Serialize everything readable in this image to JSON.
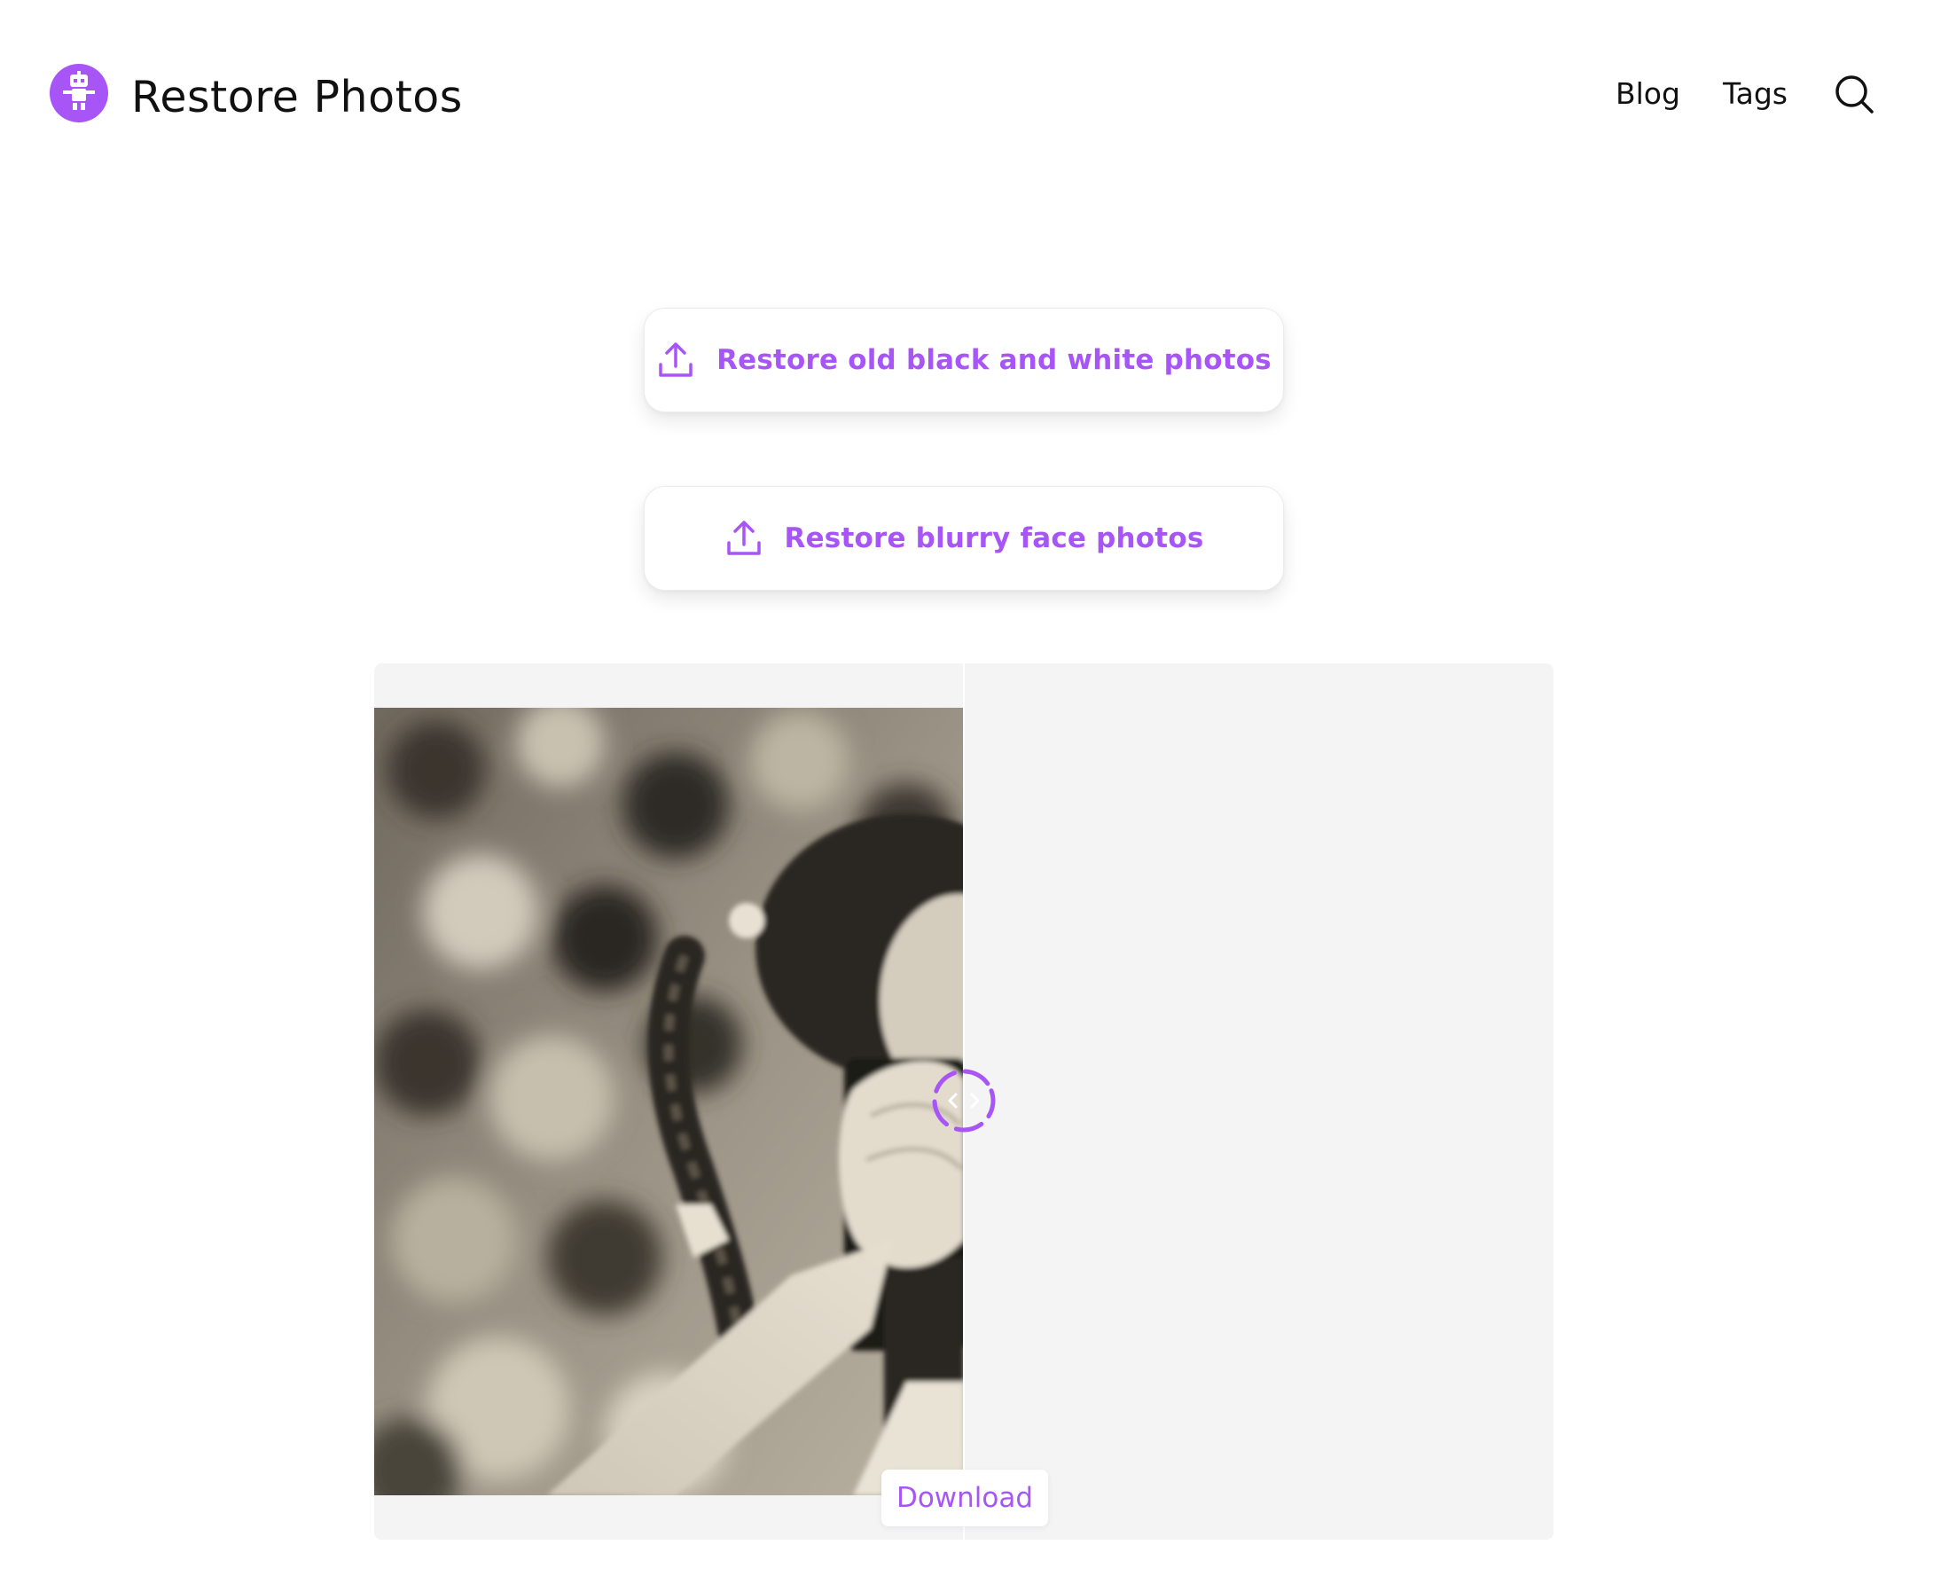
{
  "header": {
    "title": "Restore Photos",
    "logo_icon": "robot-logo-icon",
    "nav": [
      {
        "label": "Blog"
      },
      {
        "label": "Tags"
      }
    ],
    "search_icon": "search-icon"
  },
  "uploads": [
    {
      "label": "Restore old black and white photos",
      "icon": "upload-icon"
    },
    {
      "label": "Restore blurry face photos",
      "icon": "upload-icon"
    }
  ],
  "compare": {
    "split_fraction": 0.5,
    "handle_icon": "drag-handle-icon",
    "download_label": "Download"
  },
  "colors": {
    "accent": "#a855f7",
    "panel_bg": "#f4f4f5",
    "text": "#111111"
  }
}
